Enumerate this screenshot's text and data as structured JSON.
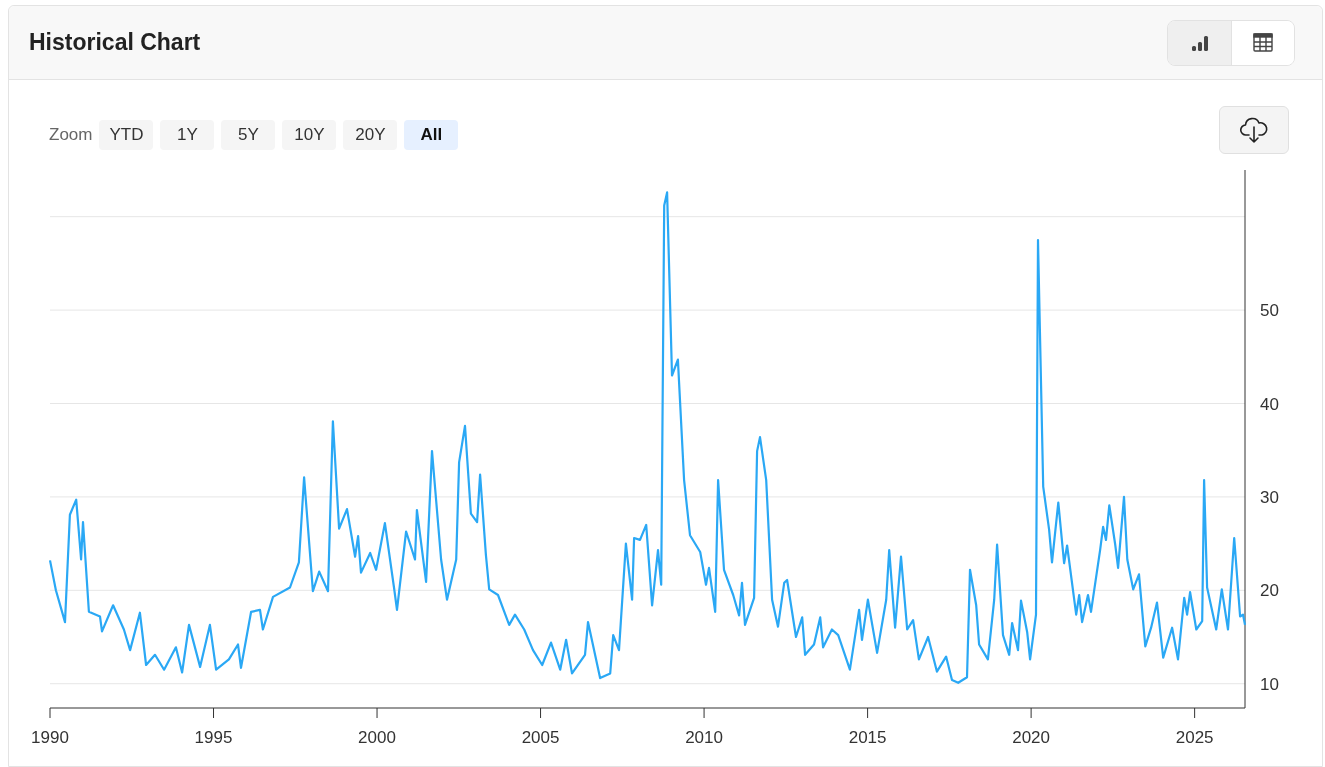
{
  "header": {
    "title": "Historical Chart",
    "view_toggle": [
      {
        "kind": "chart",
        "selected": true
      },
      {
        "kind": "table",
        "selected": false
      }
    ]
  },
  "zoom": {
    "label": "Zoom",
    "options": [
      {
        "label": "YTD",
        "selected": false
      },
      {
        "label": "1Y",
        "selected": false
      },
      {
        "label": "5Y",
        "selected": false
      },
      {
        "label": "10Y",
        "selected": false
      },
      {
        "label": "20Y",
        "selected": false
      },
      {
        "label": "All",
        "selected": true
      }
    ]
  },
  "chart": {
    "chart_data": {
      "type": "line",
      "grid": true,
      "xlim": [
        1990,
        2026.54
      ],
      "ylim": [
        7.4,
        65
      ],
      "xticks": [
        1990,
        1995,
        2000,
        2005,
        2010,
        2015,
        2020,
        2025
      ],
      "yticks": [
        10,
        20,
        30,
        40,
        50
      ],
      "x": [
        1990.0,
        1990.18,
        1990.46,
        1990.61,
        1990.8,
        1990.95,
        1991.01,
        1991.19,
        1991.53,
        1991.59,
        1991.93,
        1992.26,
        1992.45,
        1992.75,
        1992.94,
        1993.21,
        1993.49,
        1993.85,
        1994.04,
        1994.25,
        1994.59,
        1994.89,
        1995.08,
        1995.47,
        1995.75,
        1995.84,
        1996.15,
        1996.42,
        1996.51,
        1996.82,
        1997.34,
        1997.61,
        1997.77,
        1998.04,
        1998.23,
        1998.5,
        1998.65,
        1998.84,
        1999.08,
        1999.33,
        1999.42,
        1999.51,
        1999.79,
        1999.97,
        2000.24,
        2000.52,
        2000.61,
        2000.89,
        2001.16,
        2001.22,
        2001.5,
        2001.68,
        2001.96,
        2002.14,
        2002.42,
        2002.51,
        2002.69,
        2002.87,
        2003.06,
        2003.15,
        2003.33,
        2003.43,
        2003.7,
        2004.04,
        2004.22,
        2004.5,
        2004.77,
        2005.05,
        2005.32,
        2005.6,
        2005.78,
        2005.96,
        2006.36,
        2006.45,
        2006.82,
        2007.13,
        2007.22,
        2007.4,
        2007.61,
        2007.8,
        2007.86,
        2008.04,
        2008.23,
        2008.41,
        2008.59,
        2008.69,
        2008.78,
        2008.87,
        2009.02,
        2009.2,
        2009.39,
        2009.57,
        2009.88,
        2010.06,
        2010.15,
        2010.34,
        2010.43,
        2010.61,
        2010.89,
        2011.07,
        2011.16,
        2011.25,
        2011.53,
        2011.62,
        2011.71,
        2011.9,
        2012.08,
        2012.26,
        2012.45,
        2012.54,
        2012.81,
        2013.0,
        2013.09,
        2013.36,
        2013.55,
        2013.64,
        2013.91,
        2014.1,
        2014.46,
        2014.74,
        2014.83,
        2015.01,
        2015.29,
        2015.57,
        2015.66,
        2015.84,
        2016.02,
        2016.21,
        2016.39,
        2016.57,
        2016.85,
        2017.12,
        2017.4,
        2017.58,
        2017.77,
        2018.04,
        2018.13,
        2018.32,
        2018.41,
        2018.68,
        2018.87,
        2018.96,
        2019.14,
        2019.33,
        2019.42,
        2019.6,
        2019.69,
        2019.88,
        2019.97,
        2020.15,
        2020.21,
        2020.37,
        2020.55,
        2020.64,
        2020.83,
        2021.01,
        2021.1,
        2021.38,
        2021.47,
        2021.56,
        2021.74,
        2021.83,
        2022.11,
        2022.2,
        2022.29,
        2022.39,
        2022.57,
        2022.66,
        2022.84,
        2022.94,
        2023.12,
        2023.3,
        2023.49,
        2023.67,
        2023.85,
        2024.04,
        2024.31,
        2024.49,
        2024.68,
        2024.77,
        2024.86,
        2025.05,
        2025.23,
        2025.29,
        2025.38,
        2025.66,
        2025.83,
        2026.02,
        2026.21,
        2026.39,
        2026.48,
        2026.54
      ],
      "series": [
        {
          "color": "#2aa8f5",
          "values": [
            23.2,
            20.0,
            16.6,
            28.1,
            29.7,
            23.3,
            27.3,
            17.7,
            17.2,
            15.6,
            18.4,
            15.8,
            13.6,
            17.6,
            12.0,
            13.1,
            11.5,
            13.9,
            11.2,
            16.3,
            11.8,
            16.3,
            11.5,
            12.6,
            14.2,
            11.7,
            17.7,
            17.9,
            15.8,
            19.3,
            20.3,
            23.0,
            32.1,
            19.9,
            22.0,
            19.9,
            38.1,
            26.6,
            28.7,
            23.6,
            25.8,
            21.9,
            24.0,
            22.2,
            27.2,
            20.3,
            17.9,
            26.3,
            23.3,
            28.6,
            20.9,
            34.9,
            23.3,
            19.0,
            23.3,
            33.7,
            37.6,
            28.2,
            27.3,
            32.4,
            23.8,
            20.1,
            19.5,
            16.3,
            17.4,
            15.8,
            13.6,
            12.0,
            14.4,
            11.5,
            14.7,
            11.1,
            13.1,
            16.6,
            10.6,
            11.1,
            15.2,
            13.6,
            25.0,
            19.0,
            25.6,
            25.4,
            27.0,
            18.4,
            24.3,
            20.6,
            61.2,
            62.6,
            43.0,
            44.7,
            31.8,
            25.9,
            24.1,
            20.6,
            22.4,
            17.7,
            31.8,
            22.2,
            19.5,
            17.3,
            20.8,
            16.3,
            19.2,
            34.9,
            36.4,
            31.8,
            19.0,
            16.1,
            20.8,
            21.1,
            15.0,
            17.1,
            13.1,
            14.2,
            17.1,
            13.9,
            15.8,
            15.2,
            11.5,
            17.9,
            14.7,
            19.0,
            13.3,
            19.0,
            24.3,
            16.0,
            23.6,
            15.8,
            16.8,
            12.6,
            15.0,
            11.3,
            12.9,
            10.4,
            10.1,
            10.7,
            22.2,
            18.4,
            14.2,
            12.6,
            19.0,
            24.9,
            15.2,
            13.1,
            16.5,
            13.6,
            18.9,
            15.5,
            12.6,
            17.4,
            57.5,
            31.1,
            26.5,
            23.0,
            29.4,
            22.9,
            24.8,
            17.4,
            19.5,
            16.6,
            19.5,
            17.7,
            24.3,
            26.8,
            25.4,
            29.1,
            24.9,
            22.4,
            30.0,
            23.3,
            20.1,
            21.7,
            14.0,
            16.0,
            18.7,
            12.8,
            16.0,
            12.6,
            19.2,
            17.4,
            19.8,
            15.8,
            16.7,
            31.8,
            20.3,
            15.8,
            20.1,
            15.8,
            25.6,
            17.2,
            17.4,
            16.3
          ]
        }
      ]
    }
  }
}
